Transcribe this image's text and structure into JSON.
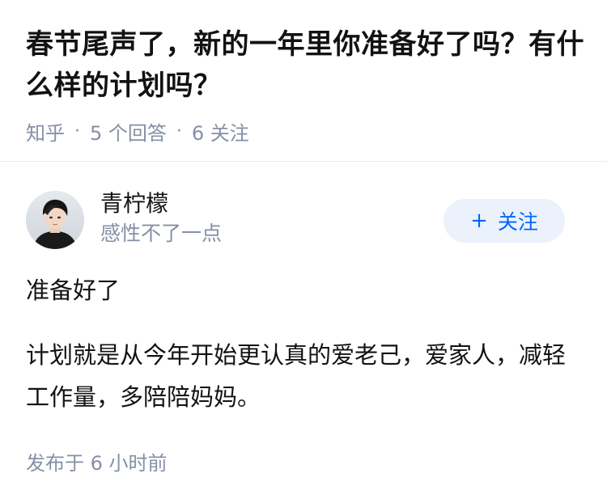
{
  "question": {
    "title": "春节尾声了，新的一年里你准备好了吗？有什么样的计划吗？",
    "source": "知乎",
    "answers_count": "5 个回答",
    "followers_count": "6 关注"
  },
  "answer": {
    "author": {
      "name": "青柠檬",
      "bio": "感性不了一点"
    },
    "follow_button": {
      "icon": "plus-icon",
      "label": "关注"
    },
    "paragraphs": [
      "准备好了",
      "计划就是从今年开始更认真的爱老己，爱家人，减轻工作量，多陪陪妈妈。"
    ],
    "publish_time": "发布于 6 小时前"
  },
  "colors": {
    "text_primary": "#121212",
    "text_secondary": "#8590a6",
    "accent": "#0066ff",
    "button_bg": "#ebf2fb",
    "divider": "#ebebeb"
  }
}
